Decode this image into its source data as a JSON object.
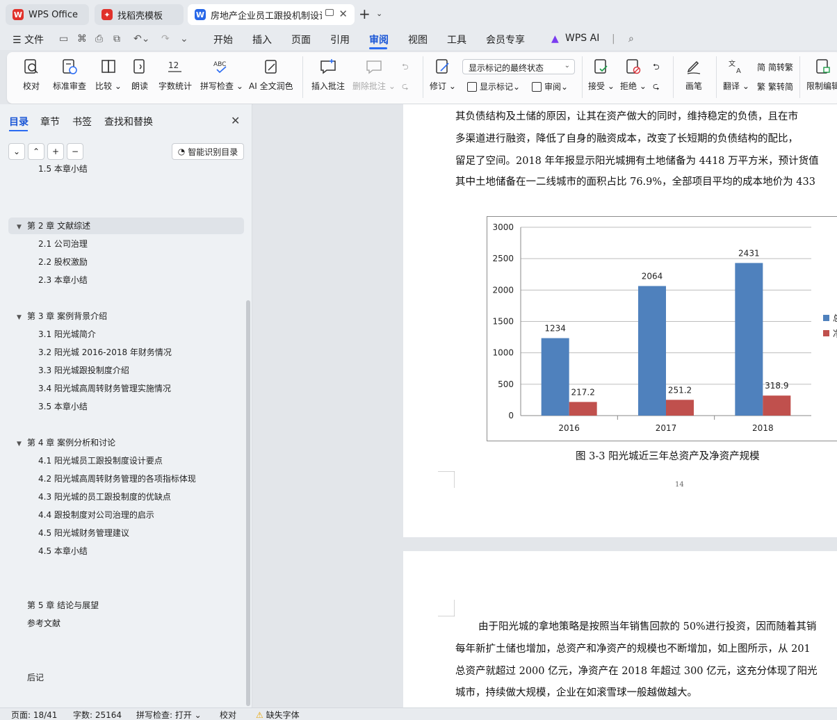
{
  "tabs": {
    "wps": "WPS Office",
    "daoke": "找稻壳模板",
    "doc": "房地产企业员工跟投机制设计与"
  },
  "menu": {
    "file": "文件",
    "items": [
      "开始",
      "插入",
      "页面",
      "引用",
      "审阅",
      "视图",
      "工具",
      "会员专享"
    ],
    "wps_ai": "WPS AI"
  },
  "ribbon": {
    "proofread": "校对",
    "standard_review": "标准审查",
    "compare": "比较",
    "read_aloud": "朗读",
    "word_count": "字数统计",
    "spell_check": "拼写检查",
    "ai_polish": "AI 全文润色",
    "insert_comment": "插入批注",
    "delete_comment": "删除批注",
    "revise": "修订",
    "markup_mode": "显示标记的最终状态",
    "show_markup": "显示标记",
    "review": "审阅",
    "accept": "接受",
    "reject": "拒绝",
    "pen": "画笔",
    "translate": "翻译",
    "trad": "繁转简",
    "trad_a": "简转繁",
    "restrict": "限制编辑"
  },
  "nav": {
    "tabs": [
      "目录",
      "章节",
      "书签",
      "查找和替换"
    ],
    "smart_toc": "智能识别目录",
    "partial_item": "1.5  本章小结",
    "chapter2": "第 2 章  文献综述",
    "c2": [
      "2.1  公司治理",
      "2.2  股权激励",
      "2.3  本章小结"
    ],
    "chapter3": "第 3 章  案例背景介绍",
    "c3": [
      "3.1  阳光城简介",
      "3.2  阳光城 2016-2018 年财务情况",
      "3.3  阳光城跟投制度介绍",
      "3.4  阳光城高周转财务管理实施情况",
      "3.5  本章小结"
    ],
    "chapter4": "第 4 章  案例分析和讨论",
    "c4": [
      "4.1  阳光城员工跟投制度设计要点",
      "4.2  阳光城高周转财务管理的各项指标体现",
      "4.3  阳光城的员工跟投制度的优缺点",
      "4.4  跟投制度对公司治理的启示",
      "4.5  阳光城财务管理建议",
      "4.5  本章小结"
    ],
    "chapter5": "第 5 章  结论与展望",
    "refs": "参考文献",
    "afterword": "后记"
  },
  "document": {
    "p1_lines": [
      "其负债结构及土储的原因，让其在资产做大的同时，维持稳定的负债，且在市",
      "多渠道进行融资，降低了自身的融资成本，改变了长短期的负债结构的配比，",
      "留足了空间。2018 年年报显示阳光城拥有土地储备为 4418 万平方米，预计货值",
      "其中土地储备在一二线城市的面积占比 76.9%，全部项目平均的成本地价为 433"
    ],
    "figure_caption": "图 3-3   阳光城近三年总资产及净资产规模",
    "page_number": "14",
    "p2_lines": [
      "由于阳光城的拿地策略是按照当年销售回款的 50%进行投资，因而随着其销",
      "每年新扩土储也增加，总资产和净资产的规模也不断增加，如上图所示，从 201",
      "总资产就超过 2000 亿元，净资产在 2018 年超过 300 亿元，这充分体现了阳光",
      "城市，持续做大规模，企业在如滚雪球一般越做越大。"
    ]
  },
  "chart_data": {
    "type": "bar",
    "categories": [
      "2016",
      "2017",
      "2018"
    ],
    "series": [
      {
        "values": [
          1234,
          2064,
          2431
        ],
        "color": "#4f81bd"
      },
      {
        "values": [
          217.2,
          251.2,
          318.9
        ],
        "color": "#c0504d"
      }
    ],
    "data_labels": [
      [
        "1234",
        "2064",
        "2431"
      ],
      [
        "217.2",
        "251.2",
        "318.9"
      ]
    ],
    "y_ticks": [
      0,
      500,
      1000,
      1500,
      2000,
      2500,
      3000
    ],
    "ylim": [
      0,
      3000
    ],
    "grid": true,
    "legend": "right",
    "legend_text": [
      "总",
      "净"
    ]
  },
  "status": {
    "page": "页面: 18/41",
    "words": "字数: 25164",
    "spell": "拼写检查: 打开",
    "proof": "校对",
    "missing_font": "缺失字体"
  },
  "colors": {
    "accent": "#2a6bf2",
    "wps_red": "#e0312b",
    "doc_blue": "#2767e8"
  }
}
